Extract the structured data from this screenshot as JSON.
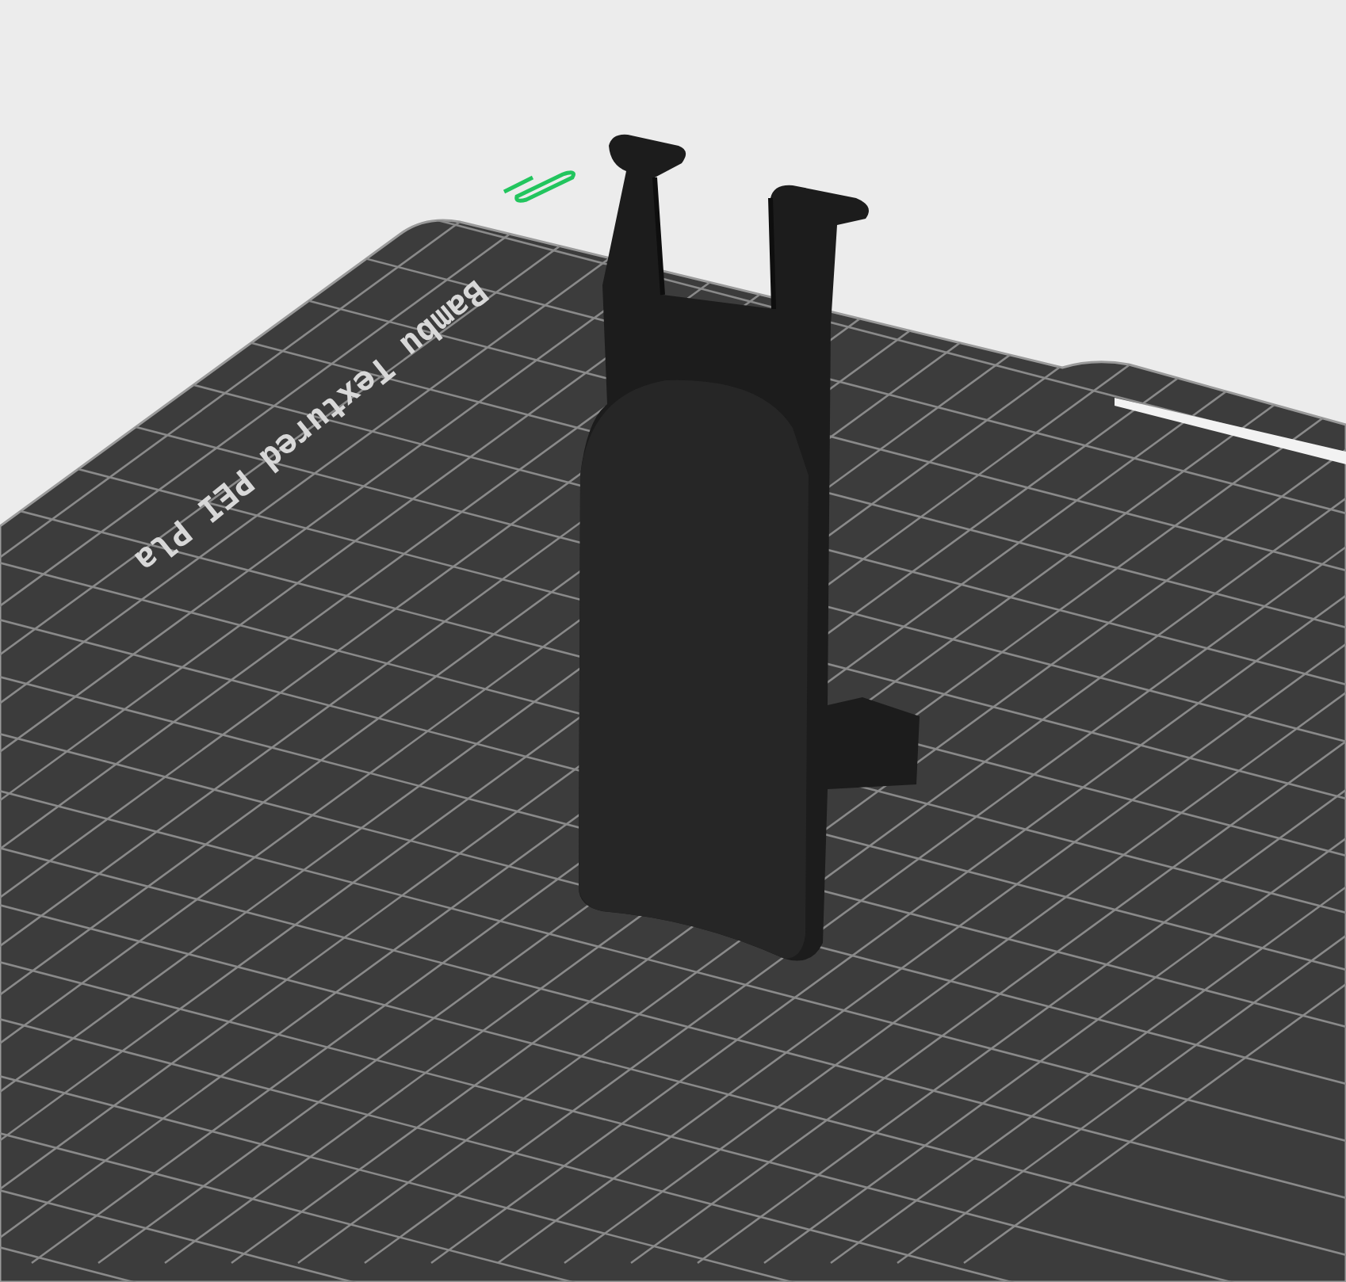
{
  "viewport": {
    "plate_label": "Bambu Textured PEI Pla"
  }
}
